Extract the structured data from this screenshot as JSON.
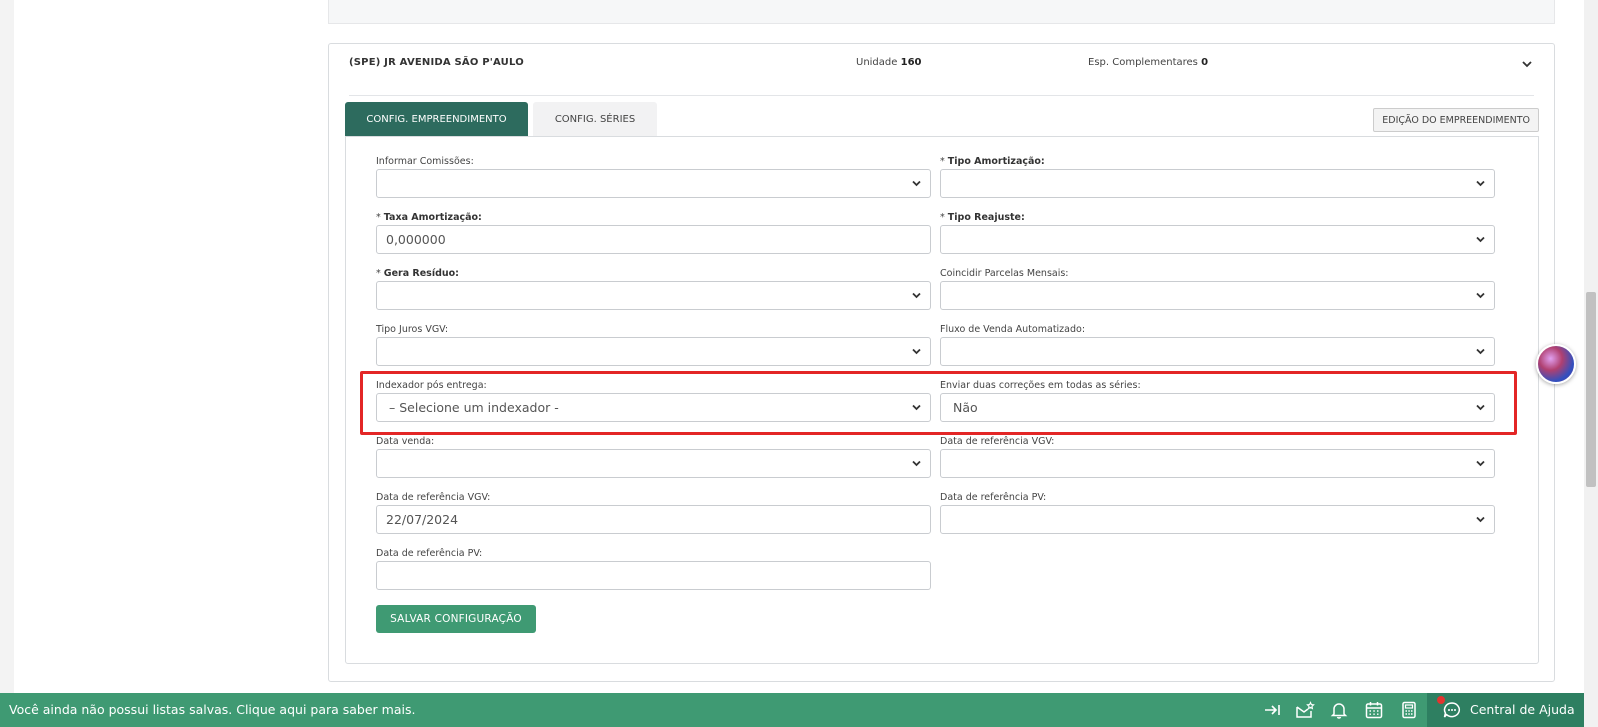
{
  "empreendimento": {
    "name": "(SPE) JR AVENIDA SÃO P'AULO",
    "unit_label": "Unidade",
    "unit_value": "160",
    "esp_label": "Esp. Complementares",
    "esp_value": "0"
  },
  "tabs": [
    {
      "label": "CONFIG. EMPREENDIMENTO",
      "active": true
    },
    {
      "label": "CONFIG. SÉRIES",
      "active": false
    }
  ],
  "edit_button": "EDIÇÃO DO EMPREENDIMENTO",
  "fields": {
    "informar_comissoes": {
      "label": "Informar Comissões:",
      "value": ""
    },
    "tipo_amortizacao": {
      "required": "* ",
      "label": "Tipo Amortização:",
      "value": ""
    },
    "taxa_amortizacao": {
      "required": "* ",
      "label": "Taxa Amortização:",
      "value": "0,000000"
    },
    "tipo_reajuste": {
      "required": "* ",
      "label": "Tipo Reajuste:",
      "value": ""
    },
    "gera_residuo": {
      "required": "* ",
      "label": "Gera Resíduo:",
      "value": ""
    },
    "coincidir_parcelas": {
      "label": "Coincidir Parcelas Mensais:",
      "value": ""
    },
    "tipo_juros_vgv": {
      "label": "Tipo Juros VGV:",
      "value": ""
    },
    "fluxo_venda": {
      "label": "Fluxo de Venda Automatizado:",
      "value": ""
    },
    "indexador": {
      "label": "Indexador pós entrega:",
      "value": "– Selecione um indexador -"
    },
    "duas_correcoes": {
      "label": "Enviar duas correções em todas as séries:",
      "value": "Não"
    },
    "data_venda": {
      "label": "Data venda:",
      "value": ""
    },
    "data_ref_vgv_select": {
      "label": "Data de referência VGV:",
      "value": ""
    },
    "data_ref_vgv_input": {
      "label": "Data de referência VGV:",
      "value": "22/07/2024"
    },
    "data_ref_pv_select": {
      "label": "Data de referência PV:",
      "value": ""
    },
    "data_ref_pv_input": {
      "label": "Data de referência PV:",
      "value": ""
    }
  },
  "save_button": "SALVAR CONFIGURAÇÃO",
  "bottom_bar": {
    "message": "Você ainda não possui listas salvas. Clique aqui para saber mais.",
    "icons": [
      "collapse-right-icon",
      "mail-star-icon",
      "bell-icon",
      "calendar-icon",
      "calculator-icon"
    ],
    "help_label": "Central de Ajuda"
  },
  "colors": {
    "primary_green": "#3f9a73",
    "dark_green": "#2d6b5e",
    "highlight_red": "#e32626"
  }
}
